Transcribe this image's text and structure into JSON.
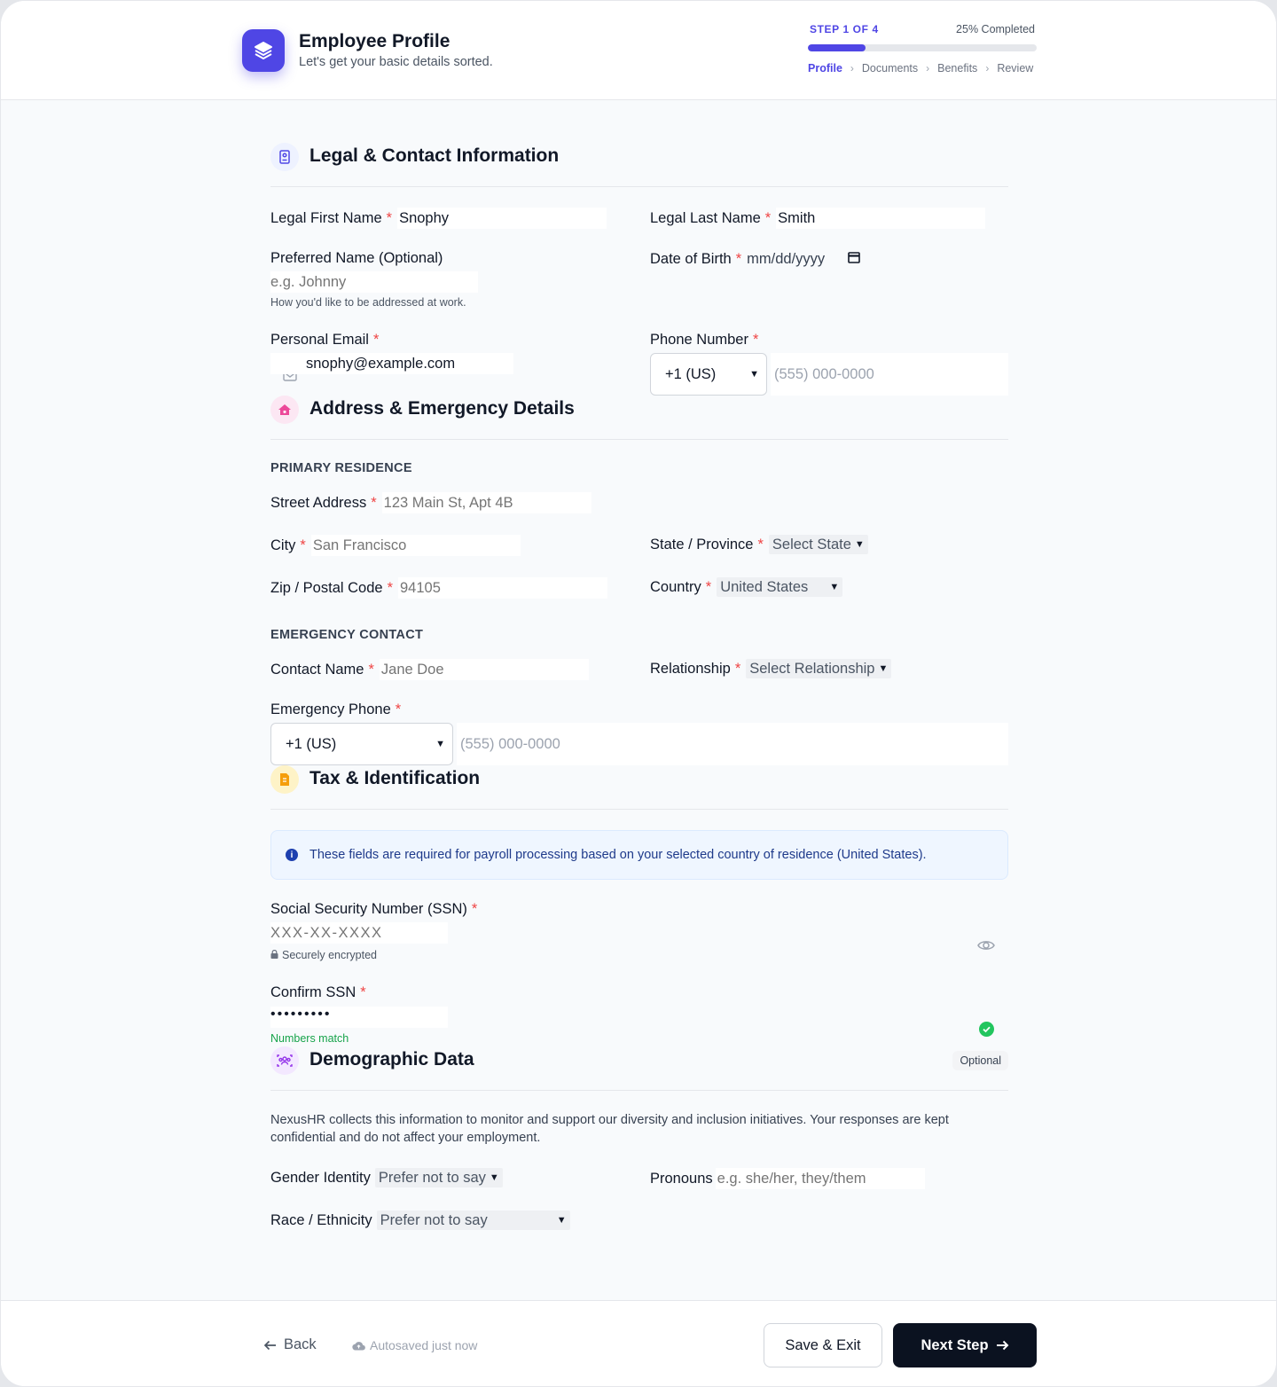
{
  "header": {
    "title": "Employee Profile",
    "subtitle": "Let's get your basic details sorted.",
    "step_label": "STEP 1 OF 4",
    "progress_text": "25% Completed",
    "progress_fraction": 0.25,
    "steps": [
      "Profile",
      "Documents",
      "Benefits",
      "Review"
    ],
    "active_step": "Profile",
    "separator": "›"
  },
  "colors": {
    "accent": "#4f46e5",
    "required": "#ef4444",
    "success": "#22c55e",
    "primary_button": "#0b1220"
  },
  "legal": {
    "title": "Legal & Contact Information",
    "icon": "id-badge-icon",
    "first_name_label": "Legal First Name",
    "first_name_value": "Snophy",
    "last_name_label": "Legal Last Name",
    "last_name_value": "Smith",
    "preferred_label": "Preferred Name (Optional)",
    "preferred_placeholder": "e.g. Johnny",
    "preferred_helper": "How you'd like to be addressed at work.",
    "dob_label": "Date of Birth",
    "dob_placeholder": "mm/dd/yyyy",
    "email_label": "Personal Email",
    "email_value": "snophy@example.com",
    "phone_label": "Phone Number",
    "phone_country": "+1 (US)",
    "phone_placeholder": "(555) 000-0000"
  },
  "address": {
    "title": "Address & Emergency Details",
    "icon": "home-icon",
    "residence_heading": "PRIMARY RESIDENCE",
    "street_label": "Street Address",
    "street_placeholder": "123 Main St, Apt 4B",
    "city_label": "City",
    "city_placeholder": "San Francisco",
    "state_label": "State / Province",
    "state_value": "Select State",
    "zip_label": "Zip / Postal Code",
    "zip_placeholder": "94105",
    "country_label": "Country",
    "country_value": "United States",
    "emergency_heading": "EMERGENCY CONTACT",
    "contact_label": "Contact Name",
    "contact_placeholder": "Jane Doe",
    "relationship_label": "Relationship",
    "relationship_value": "Select Relationship",
    "em_phone_label": "Emergency Phone",
    "em_phone_country": "+1 (US)",
    "em_phone_placeholder": "(555) 000-0000"
  },
  "tax": {
    "title": "Tax & Identification",
    "icon": "document-icon",
    "notice": "These fields are required for payroll processing based on your selected country of residence (United States).",
    "ssn_label": "Social Security Number (SSN)",
    "ssn_placeholder": "XXX-XX-XXXX",
    "ssn_helper": "Securely encrypted",
    "confirm_label": "Confirm SSN",
    "confirm_value": "•••••••••",
    "match_text": "Numbers match"
  },
  "demographic": {
    "title": "Demographic Data",
    "icon": "people-icon",
    "badge": "Optional",
    "description": "NexusHR collects this information to monitor and support our diversity and inclusion initiatives. Your responses are kept confidential and do not affect your employment.",
    "gender_label": "Gender Identity",
    "gender_value": "Prefer not to say",
    "pronouns_label": "Pronouns",
    "pronouns_placeholder": "e.g. she/her, they/them",
    "race_label": "Race / Ethnicity",
    "race_value": "Prefer not to say"
  },
  "footer": {
    "back_label": "Back",
    "autosave_text": "Autosaved just now",
    "save_label": "Save & Exit",
    "next_label": "Next Step"
  }
}
